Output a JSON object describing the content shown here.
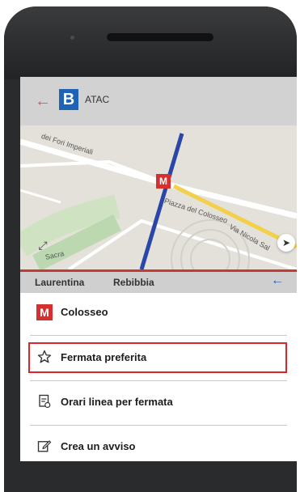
{
  "app": {
    "back_icon": "arrow-left-icon",
    "logo_letter": "B",
    "title": "ATAC"
  },
  "map": {
    "labels": {
      "fori": "dei Fori Imperiali",
      "piazza": "Piazza del Colosseo",
      "nicola": "Via Nicola Sal",
      "sacra": "Sacra"
    },
    "metro_marker": "M",
    "expand_icon": "expand-icon",
    "locate_icon": "navigation-arrow-icon"
  },
  "line_strip": {
    "from": "Laurentina",
    "to": "Rebibbia",
    "swap_icon": "arrow-left-icon"
  },
  "menu": {
    "items": [
      {
        "icon": "metro-m-icon",
        "label": "Colosseo"
      },
      {
        "icon": "star-outline-icon",
        "label": "Fermata preferita",
        "highlighted": true
      },
      {
        "icon": "timetable-icon",
        "label": "Orari linea per fermata"
      },
      {
        "icon": "edit-note-icon",
        "label": "Crea un avviso"
      }
    ]
  },
  "colors": {
    "accent_red": "#d3302f",
    "highlight_border": "#d9262a",
    "logo_blue": "#1e63b5",
    "metro_line_blue": "#2946a8"
  }
}
